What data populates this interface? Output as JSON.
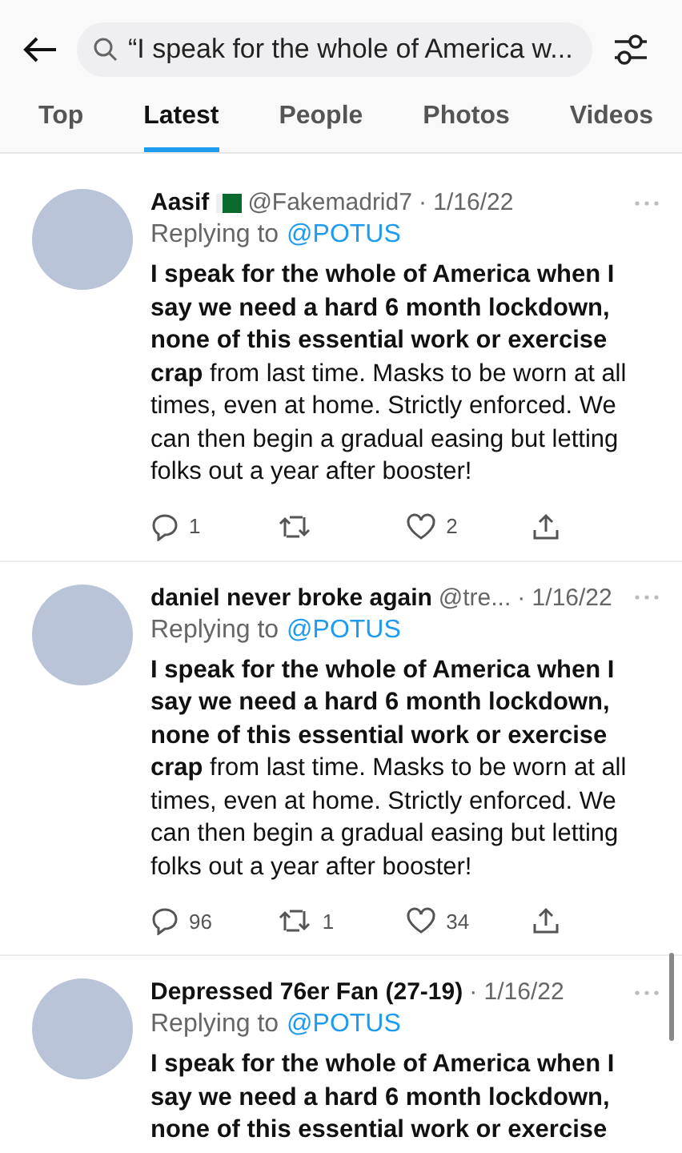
{
  "search": {
    "value": "“I speak for the whole of America w..."
  },
  "tabs": [
    {
      "label": "Top",
      "selected": false
    },
    {
      "label": "Latest",
      "selected": true
    },
    {
      "label": "People",
      "selected": false
    },
    {
      "label": "Photos",
      "selected": false
    },
    {
      "label": "Videos",
      "selected": false
    }
  ],
  "tweets": [
    {
      "name": "Aasif",
      "flag": true,
      "handle": "@Fakemadrid7",
      "date": "· 1/16/22",
      "replying_label": "Replying to",
      "replying_to": "@POTUS",
      "text": "**I speak for the whole of America when I say we need a hard 6 month lockdown, none of this essential work or exercise crap** from last time. Masks to be worn at all times, even at home. Strictly enforced. We can then begin a gradual easing but letting folks out a year after booster!",
      "replies": "1",
      "likes": "2"
    },
    {
      "name": "daniel never broke again",
      "flag": false,
      "handle": "@tre...",
      "date": "· 1/16/22",
      "replying_label": "Replying to",
      "replying_to": "@POTUS",
      "text": "**I speak for the whole of America when I say we need a hard 6 month lockdown, none of this essential work or exercise crap** from last time. Masks to be worn at all times, even at home. Strictly enforced. We can then begin a gradual easing but letting folks out a year after booster!",
      "replies": "96",
      "retweets": "1",
      "likes": "34"
    },
    {
      "name": "Depressed 76er Fan (27-19)",
      "flag": false,
      "date": "· 1/16/22",
      "replying_label": "Replying to",
      "replying_to": "@POTUS",
      "text": "**I speak for the whole of America when I say we need a hard 6 month lockdown, none of this essential work or exercise**"
    }
  ]
}
